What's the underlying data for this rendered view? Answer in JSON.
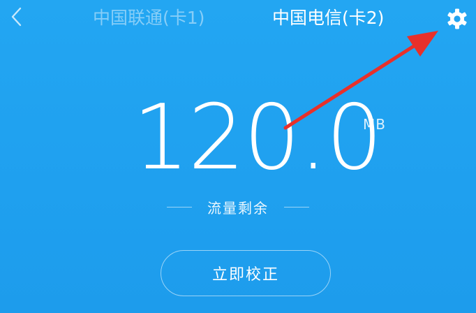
{
  "header": {
    "back_icon": "chevron-left-icon",
    "tabs": [
      {
        "label": "中国联通(卡1)",
        "active": false
      },
      {
        "label": "中国电信(卡2)",
        "active": true
      }
    ],
    "settings_icon": "gear-icon"
  },
  "usage": {
    "amount": "120.0",
    "unit": "MB",
    "label": "流量剩余"
  },
  "actions": {
    "calibrate_label": "立即校正"
  },
  "colors": {
    "background": "#1fa2f0",
    "text": "#ffffff",
    "inactive_tab": "rgba(255,255,255,0.45)",
    "annotation_arrow": "#e8302a"
  }
}
